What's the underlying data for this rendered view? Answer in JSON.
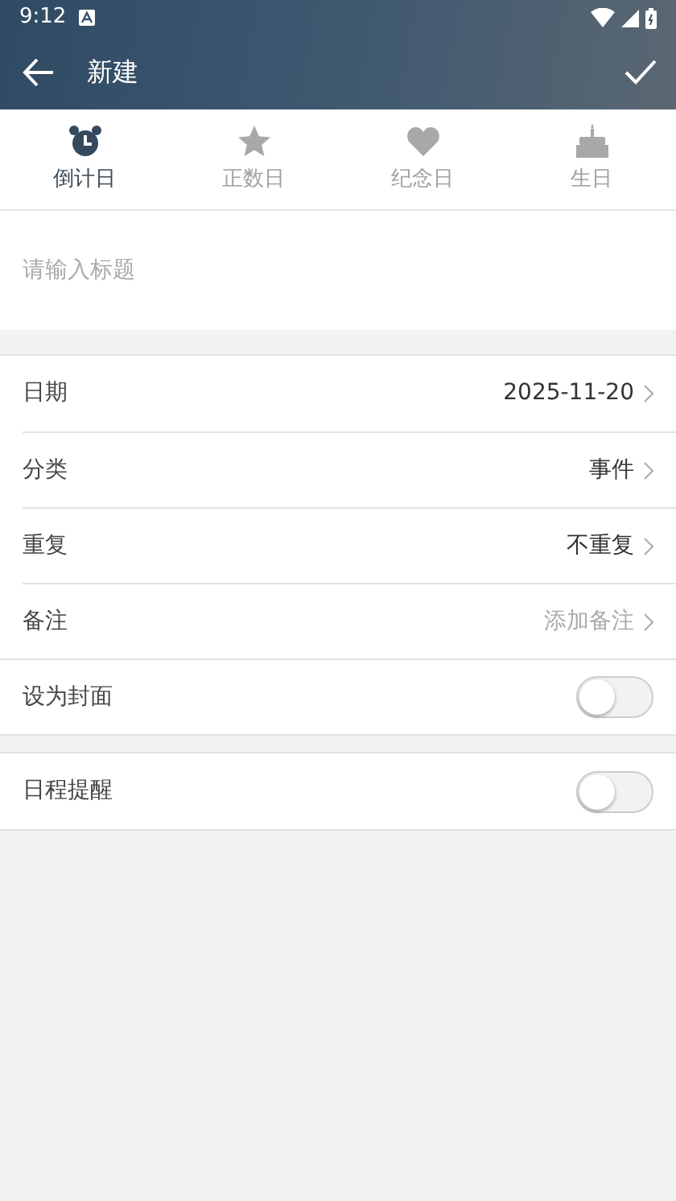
{
  "status_bar": {
    "time": "9:12"
  },
  "app_bar": {
    "title": "新建"
  },
  "tabs": [
    {
      "label": "倒计日",
      "selected": true
    },
    {
      "label": "正数日",
      "selected": false
    },
    {
      "label": "纪念日",
      "selected": false
    },
    {
      "label": "生日",
      "selected": false
    }
  ],
  "title_field": {
    "placeholder": "请输入标题"
  },
  "settings": [
    {
      "kind": "link",
      "label": "日期",
      "value": "2025-11-20"
    },
    {
      "kind": "link",
      "label": "分类",
      "value": "事件"
    },
    {
      "kind": "link",
      "label": "重复",
      "value": "不重复"
    },
    {
      "kind": "link",
      "label": "备注",
      "placeholder": "添加备注"
    },
    {
      "kind": "toggle",
      "label": "设为封面",
      "on": false
    }
  ],
  "reminder": {
    "label": "日程提醒",
    "on": false
  }
}
